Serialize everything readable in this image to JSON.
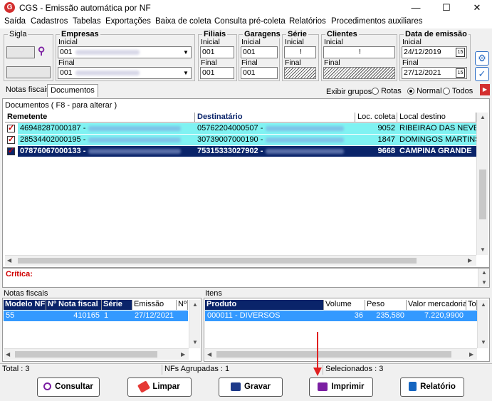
{
  "window": {
    "title": "CGS - Emissão automática por NF",
    "minimize": "—",
    "maximize": "☐",
    "close": "✕",
    "app_icon": "G"
  },
  "menu": [
    "Saída",
    "Cadastros",
    "Tabelas",
    "Exportações",
    "Baixa de coleta",
    "Consulta pré-coleta",
    "Relatórios",
    "Procedimentos auxiliares"
  ],
  "filters": {
    "sigla": {
      "label": "Sigla"
    },
    "empresas": {
      "label": "Empresas",
      "inicial_label": "Inicial",
      "final_label": "Final",
      "inicial_value": "001",
      "final_value": "001"
    },
    "filiais": {
      "label": "Filiais",
      "inicial_label": "Inicial",
      "final_label": "Final",
      "inicial_value": "001",
      "final_value": "001"
    },
    "garagens": {
      "label": "Garagens",
      "inicial_label": "Inicial",
      "final_label": "Final",
      "inicial_value": "001",
      "final_value": "001"
    },
    "serie": {
      "label": "Série",
      "inicial_label": "Inicial",
      "final_label": "Final",
      "inicial_value": "!"
    },
    "clientes": {
      "label": "Clientes",
      "inicial_label": "Inicial",
      "final_label": "Final",
      "inicial_value": "!"
    },
    "data_emissao": {
      "label": "Data de emissão",
      "inicial_label": "Inicial",
      "final_label": "Final",
      "inicial_value": "24/12/2019",
      "final_value": "27/12/2021",
      "cal_icon": "15"
    }
  },
  "tabs": {
    "notas": "Notas fiscais",
    "documentos": "Documentos"
  },
  "exibir": {
    "label": "Exibir grupos",
    "options": [
      "Rotas",
      "Normal",
      "Todos"
    ]
  },
  "documentos_header": "Documentos ( F8 - para alterar )",
  "doc_columns": [
    "Remetente",
    "Destinatário",
    "Loc. coleta",
    "Local destino"
  ],
  "doc_rows": [
    {
      "remetente": "46948287000187 -",
      "destinatario": "05762204000507 -",
      "loc": "9052",
      "local": "RIBEIRAO DAS NEVES"
    },
    {
      "remetente": "28534402000195 -",
      "destinatario": "30739007000190 -",
      "loc": "1847",
      "local": "DOMINGOS MARTINS"
    },
    {
      "remetente": "07876067000133 -",
      "destinatario": "75315333027902 -",
      "loc": "9668",
      "local": "CAMPINA GRANDE"
    }
  ],
  "critica": "Crítica:",
  "nf_section": {
    "title": "Notas fiscais",
    "columns": [
      "Modelo NF",
      "Nº Nota fiscal",
      "Série",
      "Emissão",
      "Nº"
    ],
    "rows": [
      {
        "modelo": "55",
        "numero": "410165",
        "serie": "1",
        "emissao": "27/12/2021"
      }
    ]
  },
  "itens_section": {
    "title": "Itens",
    "columns": [
      "Produto",
      "Volume",
      "Peso",
      "Valor mercadoria",
      "To"
    ],
    "rows": [
      {
        "produto": "000011 - DIVERSOS",
        "volume": "36",
        "peso": "235,580",
        "valor": "7.220,9900"
      }
    ]
  },
  "status": {
    "total": "Total : 3",
    "agrupadas": "NFs Agrupadas : 1",
    "selecionados": "Selecionados : 3"
  },
  "buttons": {
    "consultar": "Consultar",
    "limpar": "Limpar",
    "gravar": "Gravar",
    "imprimir": "Imprimir",
    "relatorio": "Relatório"
  },
  "colors": {
    "accent": "#0a246a",
    "highlight": "#7ff2f2",
    "red": "#d32f2f",
    "critica": "#d00000"
  }
}
